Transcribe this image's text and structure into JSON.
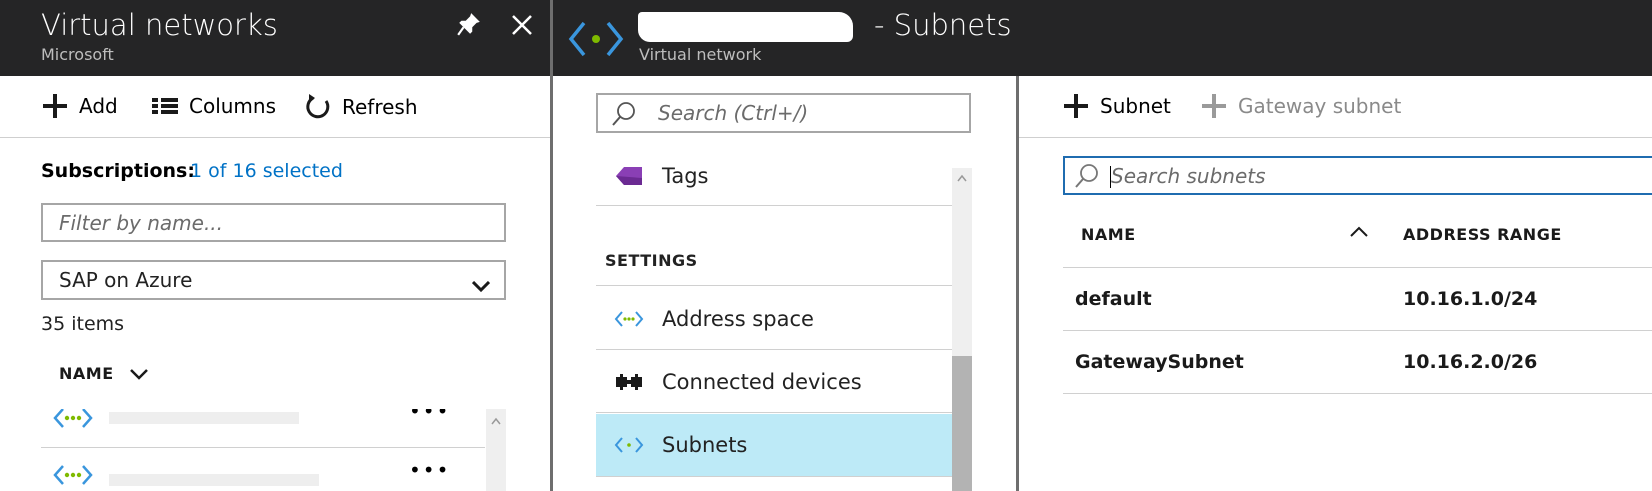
{
  "left_blade": {
    "title": "Virtual networks",
    "subtitle": "Microsoft",
    "commands": {
      "add": "Add",
      "columns": "Columns",
      "refresh": "Refresh"
    },
    "subscriptions_label": "Subscriptions:",
    "subscriptions_value": "1 of 16 selected",
    "filter_placeholder": "Filter by name...",
    "subscription_select": "SAP on Azure",
    "items_count": "35 items",
    "name_header": "NAME",
    "more_label": "•••"
  },
  "middle_blade": {
    "title_suffix": "- Subnets",
    "subtitle": "Virtual network",
    "search_placeholder": "Search (Ctrl+/)",
    "tags_label": "Tags",
    "settings_heading": "SETTINGS",
    "menu": [
      {
        "label": "Address space",
        "icon": "vnet-icon"
      },
      {
        "label": "Connected devices",
        "icon": "connected-devices-icon"
      },
      {
        "label": "Subnets",
        "icon": "vnet-icon",
        "selected": true
      }
    ]
  },
  "right_blade": {
    "commands": {
      "subnet": "Subnet",
      "gateway_subnet": "Gateway subnet"
    },
    "search_placeholder": "Search subnets",
    "columns": {
      "name": "NAME",
      "address_range": "ADDRESS RANGE"
    },
    "rows": [
      {
        "name": "default",
        "range": "10.16.1.0/24"
      },
      {
        "name": "GatewaySubnet",
        "range": "10.16.2.0/26"
      }
    ]
  },
  "colors": {
    "header_bg": "#252526",
    "link": "#0072c6",
    "selected_bg": "#bdeaf7",
    "vnet_blue": "#3a96dd",
    "vnet_green": "#7fba00"
  }
}
